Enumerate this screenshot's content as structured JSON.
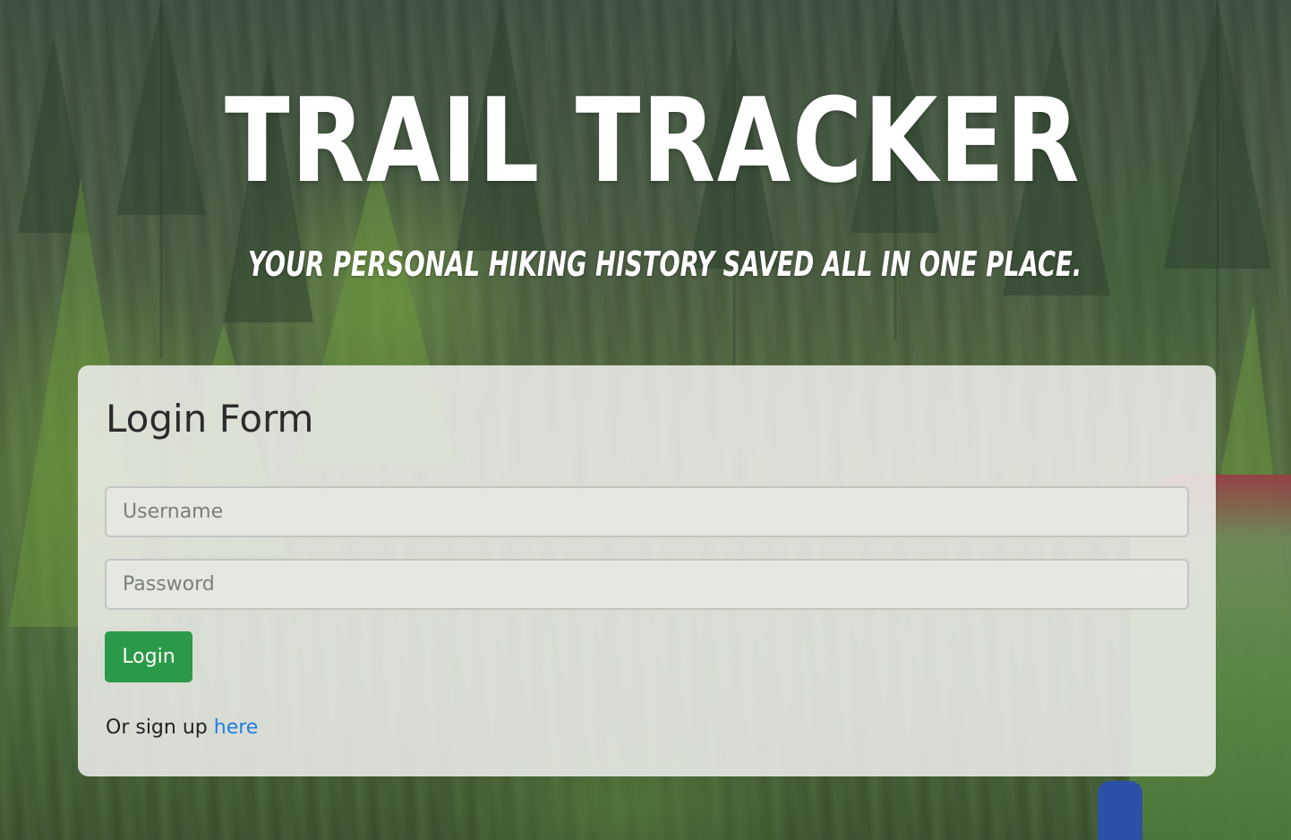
{
  "hero": {
    "title": "TRAIL TRACKER",
    "subtitle": "YOUR PERSONAL HIKING HISTORY SAVED ALL IN ONE PLACE."
  },
  "login_form": {
    "title": "Login Form",
    "username_placeholder": "Username",
    "password_placeholder": "Password",
    "login_label": "Login",
    "signup_prefix": "Or sign up",
    "signup_link": "here"
  },
  "colors": {
    "login_button": "#2a9a48",
    "link": "#1f7fe0",
    "card": "#f0f0ee"
  },
  "background": {
    "description_icon": "forest-photo"
  }
}
